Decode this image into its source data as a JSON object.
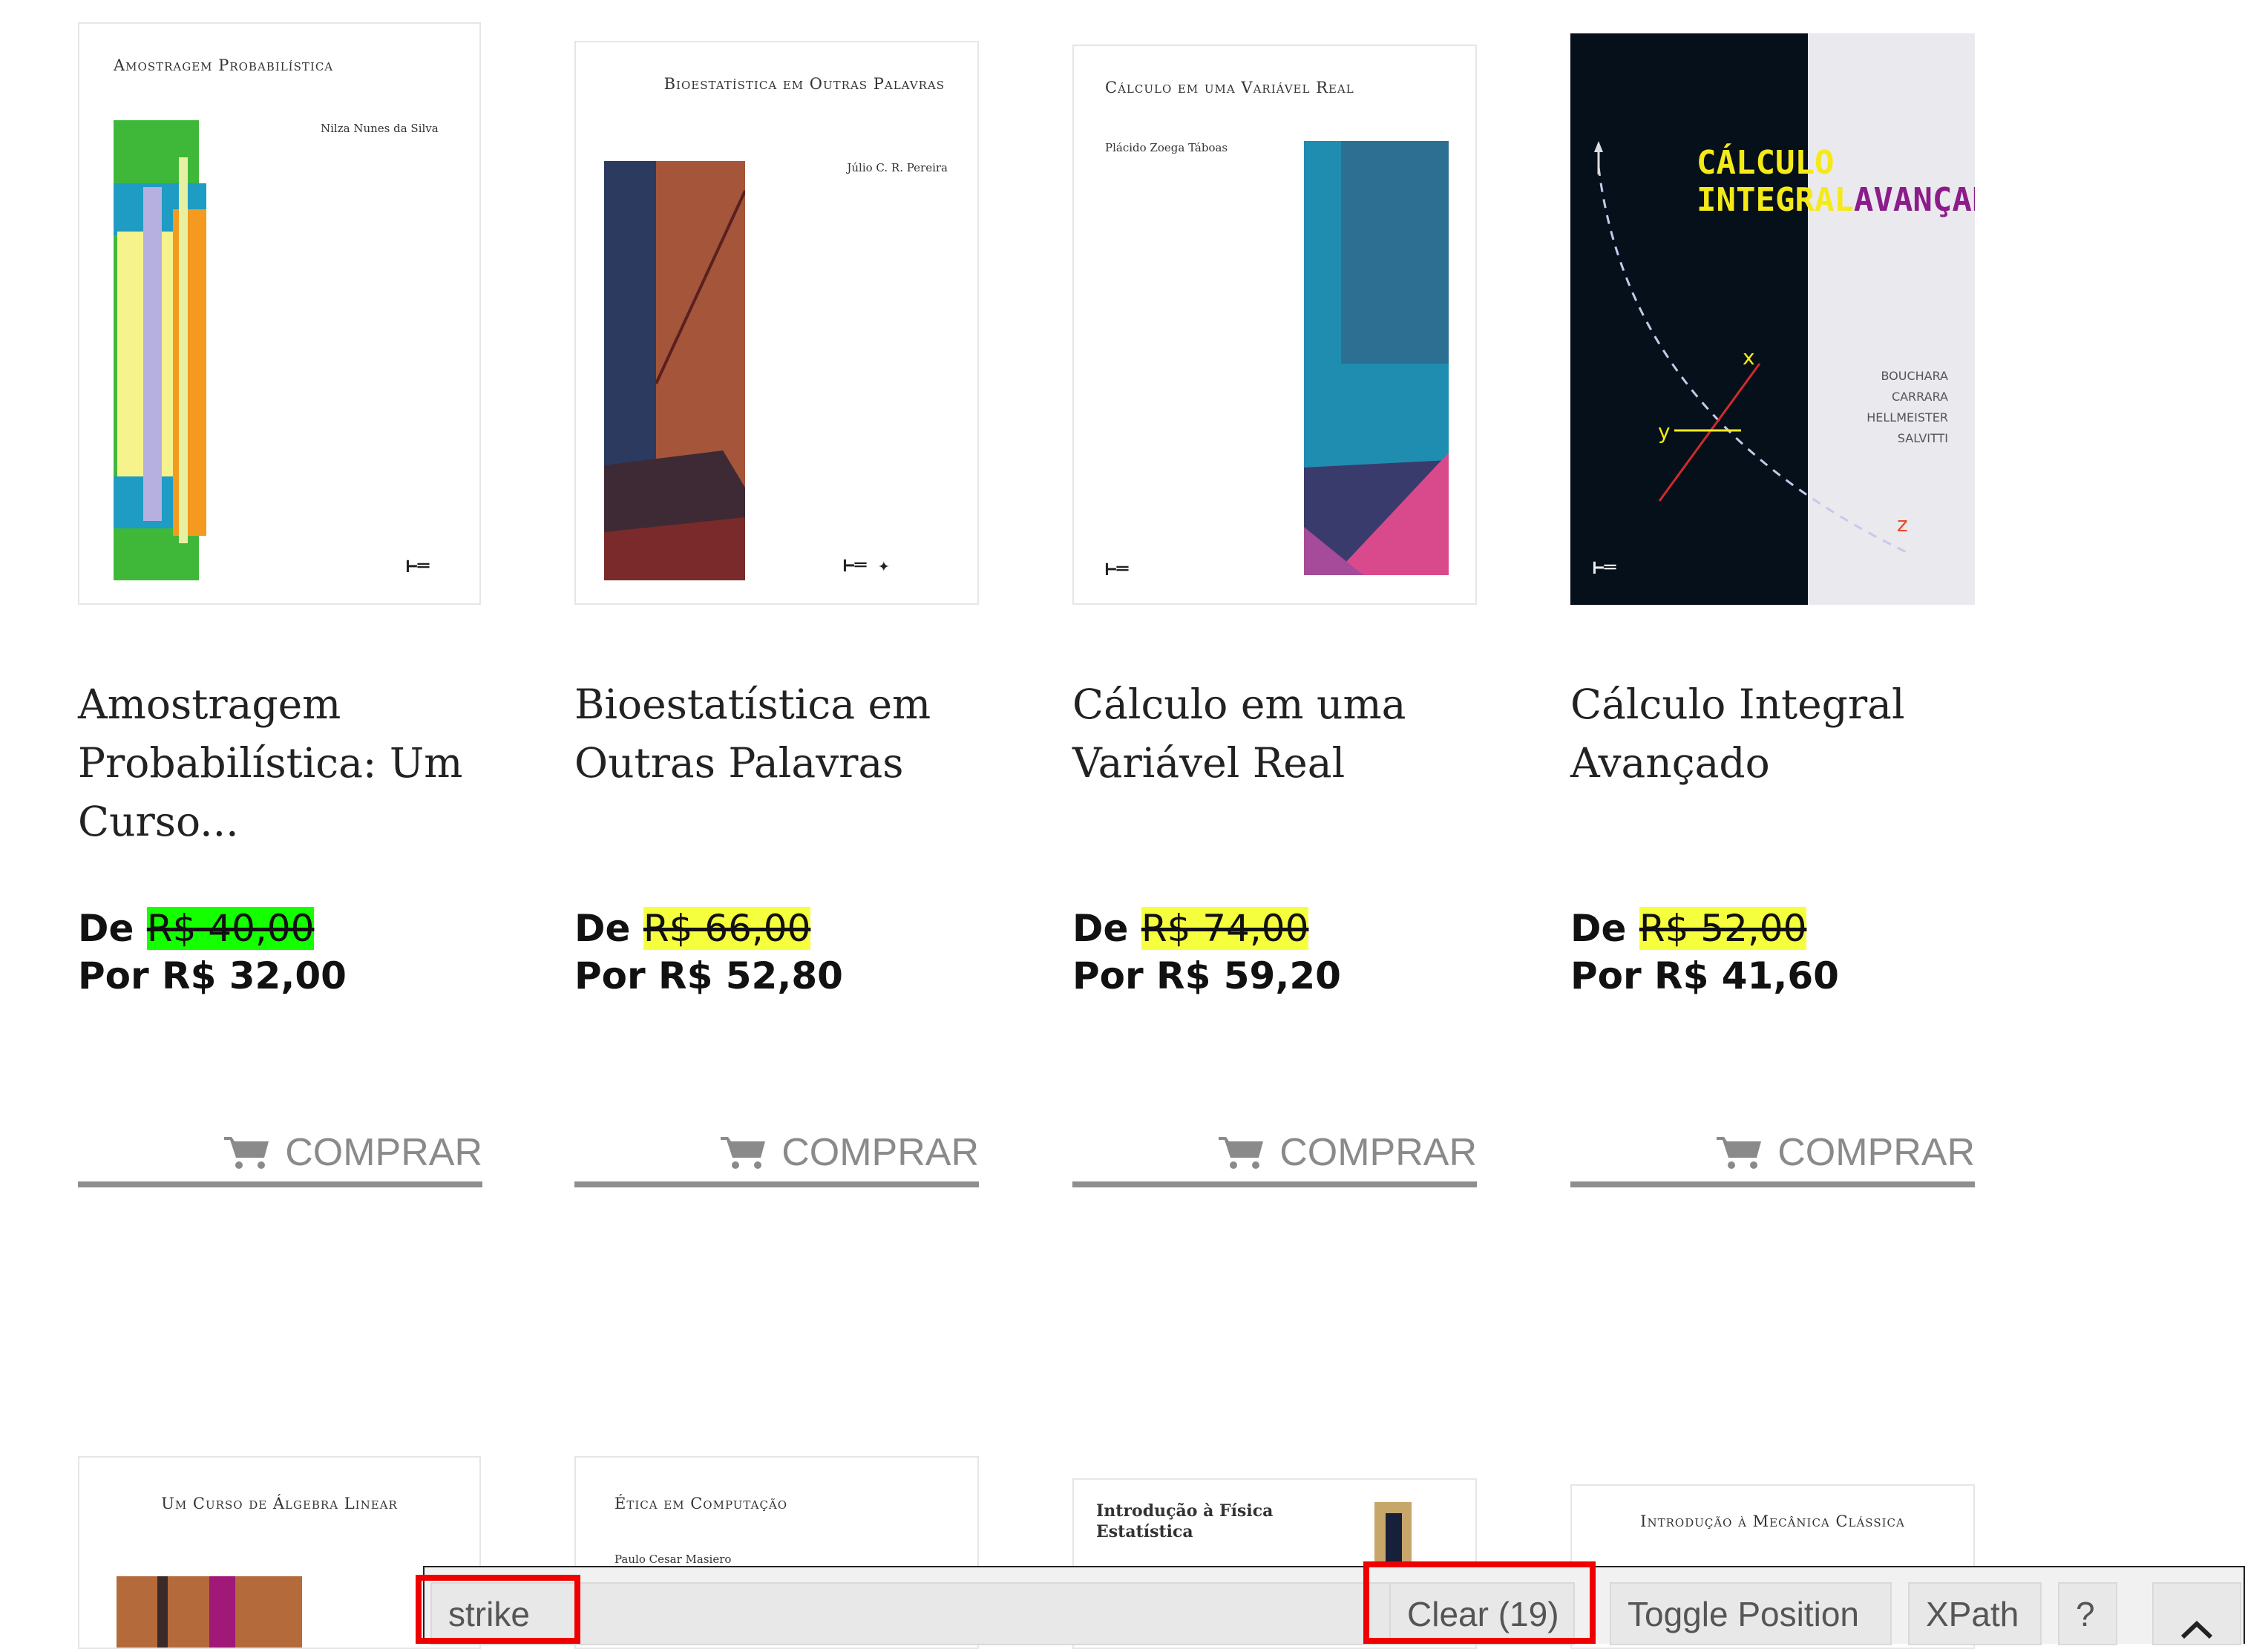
{
  "products": [
    {
      "cover": {
        "title": "Amostragem Probabilística",
        "author": "Nilza Nunes da Silva"
      },
      "title_lines": [
        "Amostragem",
        "Probabilística: Um",
        "Curso..."
      ],
      "price_old_prefix": "De",
      "price_old": "R$ 40,00",
      "price_new": "Por R$ 32,00",
      "highlight": "#14ff00",
      "buy_label": "COMPRAR"
    },
    {
      "cover": {
        "title": "Bioestatística em Outras Palavras",
        "author": "Júlio C. R. Pereira"
      },
      "title_lines": [
        "Bioestatística em",
        "Outras Palavras"
      ],
      "price_old_prefix": "De",
      "price_old": "R$ 66,00",
      "price_new": "Por R$ 52,80",
      "highlight": "#f6ff3d",
      "buy_label": "COMPRAR"
    },
    {
      "cover": {
        "title": "Cálculo em uma Variável Real",
        "author": "Plácido Zoega Táboas"
      },
      "title_lines": [
        "Cálculo em uma",
        "Variável Real"
      ],
      "price_old_prefix": "De",
      "price_old": "R$ 74,00",
      "price_new": "Por R$ 59,20",
      "highlight": "#f6ff3d",
      "buy_label": "COMPRAR"
    },
    {
      "cover": {
        "title_a": "CÁLCULO",
        "title_b": "INTEGRAL",
        "title_c": "AVANÇADO",
        "authors": [
          "BOUCHARA",
          "CARRARA",
          "HELLMEISTER",
          "SALVITTI"
        ],
        "axis_x": "x",
        "axis_y": "y",
        "axis_z": "z"
      },
      "title_lines": [
        "Cálculo Integral",
        "Avançado"
      ],
      "price_old_prefix": "De",
      "price_old": "R$ 52,00",
      "price_new": "Por R$ 41,60",
      "highlight": "#f6ff3d",
      "buy_label": "COMPRAR"
    }
  ],
  "second_row_covers": [
    {
      "title": "Um Curso de Álgebra Linear"
    },
    {
      "title": "Ética em Computação",
      "author": "Paulo Cesar Masiero"
    },
    {
      "title": "Introdução à Física Estatística"
    },
    {
      "title": "Introdução à Mecânica Clássica"
    }
  ],
  "toolbar": {
    "input_value": "strike",
    "clear_label": "Clear (19)",
    "toggle_label": "Toggle Position",
    "xpath_label": "XPath",
    "help_label": "?",
    "chevron_icon": "chevron-up-icon"
  },
  "colors": {
    "outline_red": "#ee0000",
    "buy_gray": "#8a8a8a"
  }
}
